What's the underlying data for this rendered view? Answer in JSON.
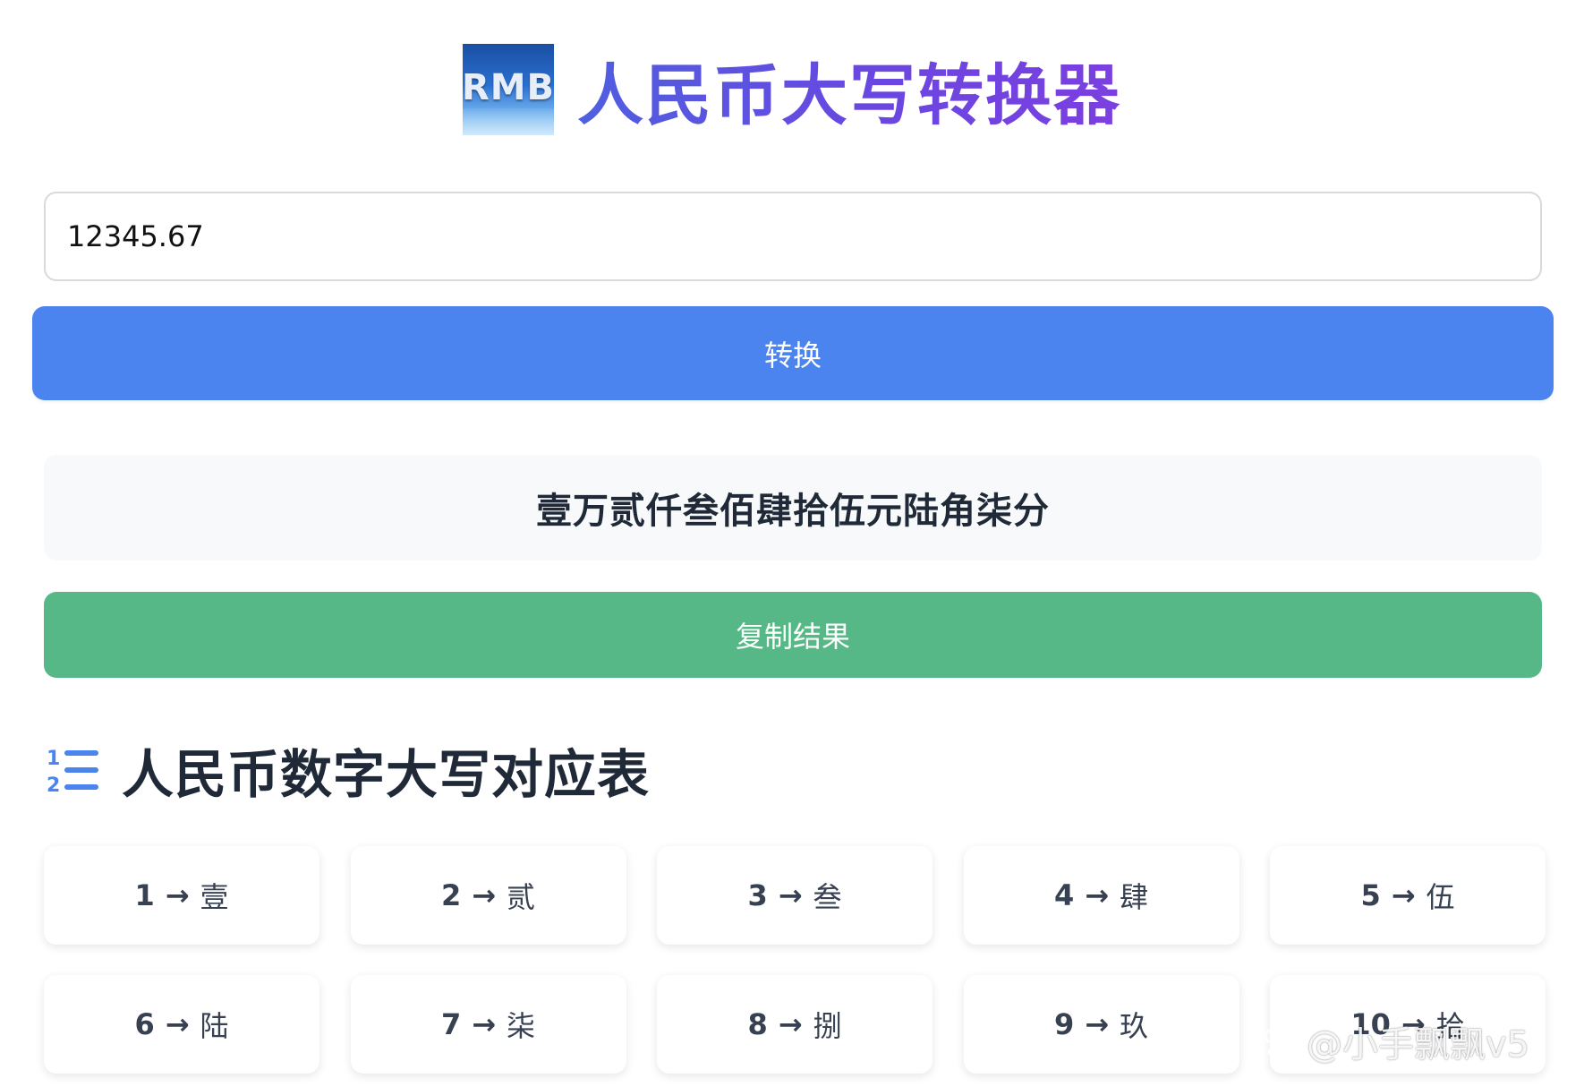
{
  "header": {
    "logo_text": "RMB",
    "title": "人民币大写转换器"
  },
  "input": {
    "value": "12345.67"
  },
  "convert_button": "转换",
  "result": "壹万贰仟叁佰肆拾伍元陆角柒分",
  "copy_button": "复制结果",
  "section": {
    "title": "人民币数字大写对应表"
  },
  "table": [
    {
      "num": "1",
      "arrow": "→",
      "char": "壹"
    },
    {
      "num": "2",
      "arrow": "→",
      "char": "贰"
    },
    {
      "num": "3",
      "arrow": "→",
      "char": "叁"
    },
    {
      "num": "4",
      "arrow": "→",
      "char": "肆"
    },
    {
      "num": "5",
      "arrow": "→",
      "char": "伍"
    },
    {
      "num": "6",
      "arrow": "→",
      "char": "陆"
    },
    {
      "num": "7",
      "arrow": "→",
      "char": "柒"
    },
    {
      "num": "8",
      "arrow": "→",
      "char": "捌"
    },
    {
      "num": "9",
      "arrow": "→",
      "char": "玖"
    },
    {
      "num": "10",
      "arrow": "→",
      "char": "拾"
    }
  ],
  "watermark": "@小手飘飘v5",
  "colors": {
    "convert_button": "#4b84ee",
    "copy_button": "#55b886",
    "title_gradient_start": "#4f5fe0",
    "title_gradient_end": "#7b3fe0"
  },
  "icons": {
    "list": "numbered-list-icon",
    "watermark": "baidu-paw-icon"
  }
}
